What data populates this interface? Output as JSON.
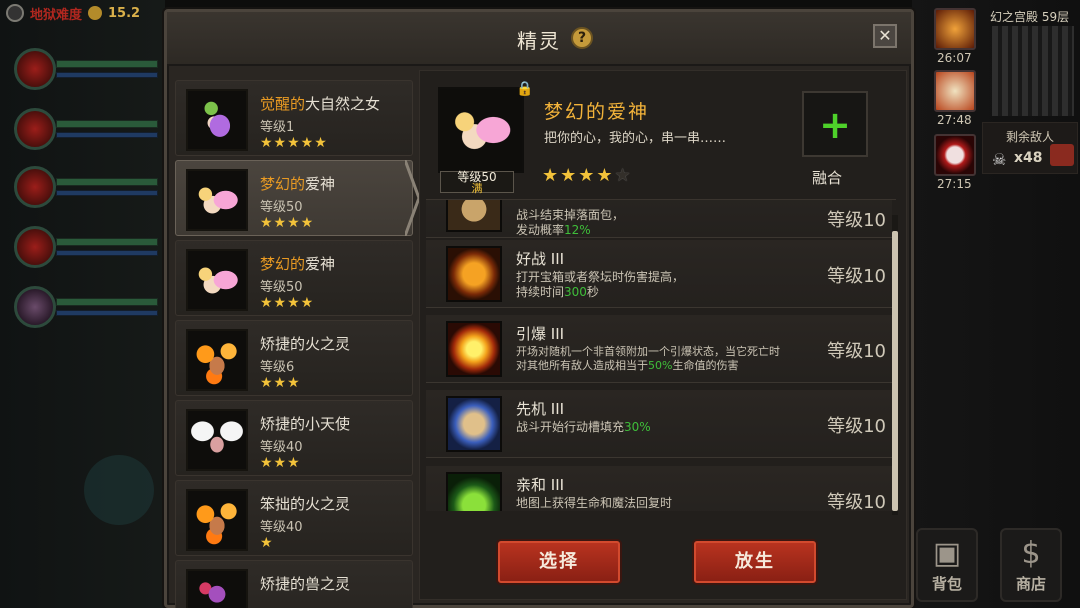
{
  "hud": {
    "difficulty": "地狱难度",
    "gold": "15.2",
    "floor": "幻之宫殿 59层",
    "enemies_label": "剩余敌人",
    "enemies_count": "x48",
    "buff_times": [
      "26:07",
      "27:48",
      "27:15"
    ],
    "bag_label": "背包",
    "shop_label": "商店"
  },
  "dialog": {
    "title": "精灵",
    "help": "?",
    "close": "✕"
  },
  "spirit_list": [
    {
      "name_hl": "觉醒的",
      "name": "大自然之女",
      "level": "等级1",
      "stars": "★★★★★",
      "sprite": "nature"
    },
    {
      "name_hl": "梦幻的",
      "name": "爱神",
      "level": "等级50",
      "stars": "★★★★",
      "sprite": "cupid",
      "selected": true
    },
    {
      "name_hl": "梦幻的",
      "name": "爱神",
      "level": "等级50",
      "stars": "★★★★",
      "sprite": "cupid"
    },
    {
      "name_hl": "",
      "name": "矫捷的火之灵",
      "level": "等级6",
      "stars": "★★★",
      "sprite": "fire"
    },
    {
      "name_hl": "",
      "name": "矫捷的小天使",
      "level": "等级40",
      "stars": "★★★",
      "sprite": "angel"
    },
    {
      "name_hl": "",
      "name": "笨拙的火之灵",
      "level": "等级40",
      "stars": "★",
      "sprite": "fire"
    },
    {
      "name_hl": "",
      "name": "矫捷的兽之灵",
      "level": "",
      "stars": "",
      "sprite": "beast"
    }
  ],
  "detail": {
    "name": "梦幻的爱神",
    "description": "把你的心，我的心，串一串……",
    "level_plate": "等级50",
    "level_max": "满",
    "stars_filled": "★★★★",
    "stars_empty": "★",
    "fuse_label": "融合"
  },
  "skills": [
    {
      "icon": "prev",
      "name": "",
      "desc_pre": "战斗结束掉落面包，",
      "desc_mid": "发动概率",
      "desc_green": "12%",
      "desc_post": "",
      "level": "等级10"
    },
    {
      "icon": "combat",
      "name": "好战 III",
      "desc_pre": "打开宝箱或者祭坛时伤害提高，",
      "desc_mid": "持续时间",
      "desc_green": "300",
      "desc_post": "秒",
      "level": "等级10"
    },
    {
      "icon": "explode",
      "name": "引爆 III",
      "desc_pre": "开场对随机一个非首领附加一个引爆状态，当它死亡时",
      "desc_mid": "对其他所有敌人造成相当于",
      "desc_green": "50%",
      "desc_post": "生命值的伤害",
      "level": "等级10"
    },
    {
      "icon": "first",
      "name": "先机 III",
      "desc_pre": "",
      "desc_mid": "战斗开始行动槽填充",
      "desc_green": "30%",
      "desc_post": "",
      "level": "等级10"
    },
    {
      "icon": "affinity",
      "name": "亲和 III",
      "desc_pre": "地图上获得生命和魔法回复时",
      "desc_mid": "",
      "desc_green": "",
      "desc_post": "",
      "level": "等级10"
    }
  ],
  "buttons": {
    "select": "选择",
    "release": "放生"
  }
}
